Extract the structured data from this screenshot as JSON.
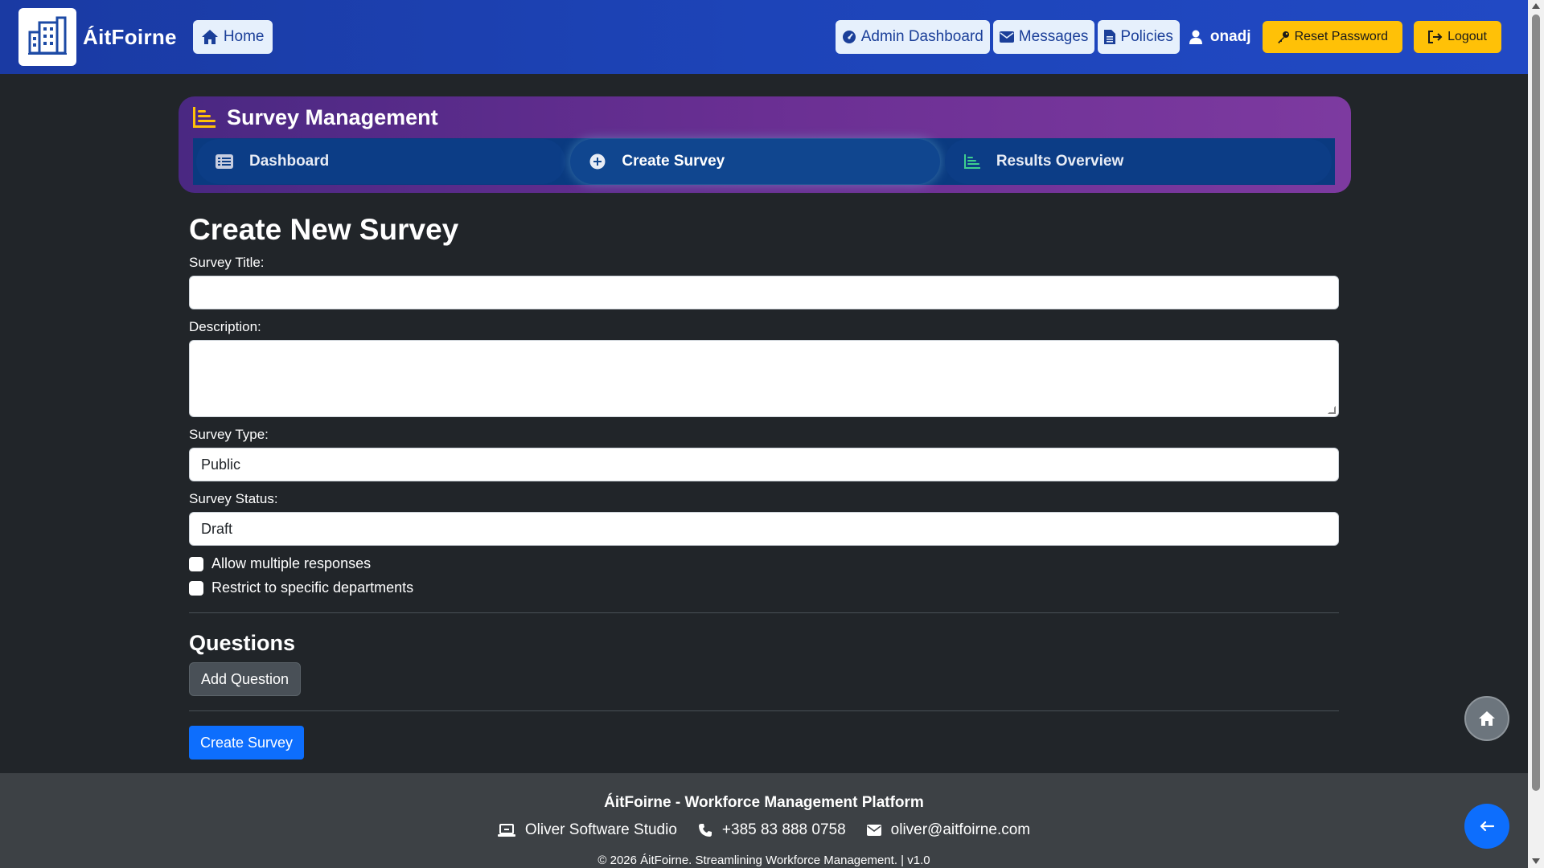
{
  "navbar": {
    "brand_name": "ÁitFoirne",
    "home_label": "Home",
    "admin_dashboard_label": "Admin Dashboard",
    "messages_label": "Messages",
    "policies_label": "Policies",
    "username": "onadj",
    "reset_password_label": "Reset Password",
    "logout_label": "Logout"
  },
  "survey_header": {
    "title": "Survey Management",
    "tabs": [
      {
        "label": "Dashboard",
        "icon": "list-icon"
      },
      {
        "label": "Create Survey",
        "icon": "plus-circle-icon",
        "active": true
      },
      {
        "label": "Results Overview",
        "icon": "bar-chart-icon"
      }
    ]
  },
  "form": {
    "heading": "Create New Survey",
    "title_label": "Survey Title:",
    "title_value": "",
    "description_label": "Description:",
    "description_value": "",
    "type_label": "Survey Type:",
    "type_value": "Public",
    "status_label": "Survey Status:",
    "status_value": "Draft",
    "allow_multiple_label": "Allow multiple responses",
    "restrict_departments_label": "Restrict to specific departments",
    "questions_heading": "Questions",
    "add_question_label": "Add Question",
    "submit_label": "Create Survey"
  },
  "footer": {
    "title": "ÁitFoirne - Workforce Management Platform",
    "company": "Oliver Software Studio",
    "phone": "+385 83 888 0758",
    "email": "oliver@aitfoirne.com",
    "copyright": "© 2026 ÁitFoirne. Streamlining Workforce Management. | v1.0"
  },
  "colors": {
    "navbar": "#1d44b8",
    "accent_yellow": "#ffc107",
    "primary": "#0d6efd",
    "background": "#212529",
    "survey_card": "#6a2f93"
  }
}
